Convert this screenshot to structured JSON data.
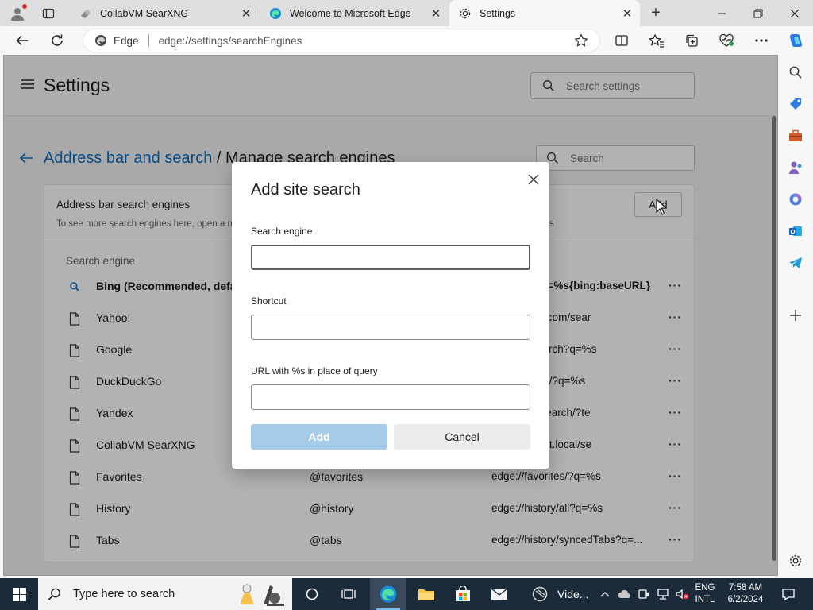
{
  "browser": {
    "tabs": [
      {
        "title": "CollabVM SearXNG",
        "active": false
      },
      {
        "title": "Welcome to Microsoft Edge",
        "active": false
      },
      {
        "title": "Settings",
        "active": true
      }
    ],
    "new_tab_label": "+",
    "omnibox": {
      "site_label": "Edge",
      "url": "edge://settings/searchEngines"
    },
    "accent_color": "#0f6cbd"
  },
  "settings": {
    "title": "Settings",
    "search_placeholder": "Search settings",
    "breadcrumb": {
      "parent": "Address bar and search",
      "separator": " / ",
      "current": "Manage search engines"
    },
    "list_search_placeholder": "Search",
    "card": {
      "title": "Address bar search engines",
      "description": "To see more search engines here, open a n",
      "description_tail": "s",
      "add_label": "Add",
      "column_header": "Search engine",
      "rows": [
        {
          "name": "Bing (Recommended, defau",
          "shortcut": "",
          "url": "{bing:baseURL}search?q=%s&...",
          "icon": "search-icon",
          "bold": true
        },
        {
          "name": "Yahoo!",
          "shortcut": "",
          "url": "ch.yahoo.com/sear...",
          "icon": "page-icon",
          "bold": false
        },
        {
          "name": "Google",
          "shortcut": "",
          "url": "eURL}search?q=%s...",
          "icon": "page-icon",
          "bold": false
        },
        {
          "name": "DuckDuckGo",
          "shortcut": "",
          "url": "duckgo.com/?q=%s",
          "icon": "page-icon",
          "bold": false
        },
        {
          "name": "Yandex",
          "shortcut": "",
          "url": "lex.com/search/?te...",
          "icon": "page-icon",
          "bold": false
        },
        {
          "name": "CollabVM SearXNG",
          "shortcut": "",
          "url": "h.collabnet.local/se...",
          "icon": "page-icon",
          "bold": false
        },
        {
          "name": "Favorites",
          "shortcut": "@favorites",
          "url": "edge://favorites/?q=%s",
          "icon": "page-icon",
          "bold": false
        },
        {
          "name": "History",
          "shortcut": "@history",
          "url": "edge://history/all?q=%s",
          "icon": "page-icon",
          "bold": false
        },
        {
          "name": "Tabs",
          "shortcut": "@tabs",
          "url": "edge://history/syncedTabs?q=...",
          "icon": "page-icon",
          "bold": false
        }
      ],
      "more_label": "···"
    }
  },
  "dialog": {
    "title": "Add site search",
    "fields": [
      {
        "label": "Search engine",
        "value": ""
      },
      {
        "label": "Shortcut",
        "value": ""
      },
      {
        "label": "URL with %s in place of query",
        "value": ""
      }
    ],
    "add_label": "Add",
    "cancel_label": "Cancel"
  },
  "taskbar": {
    "search_placeholder": "Type here to search",
    "video_label": "Vide...",
    "lang_line1": "ENG",
    "lang_line2": "INTL",
    "time": "7:58 AM",
    "date": "6/2/2024"
  }
}
